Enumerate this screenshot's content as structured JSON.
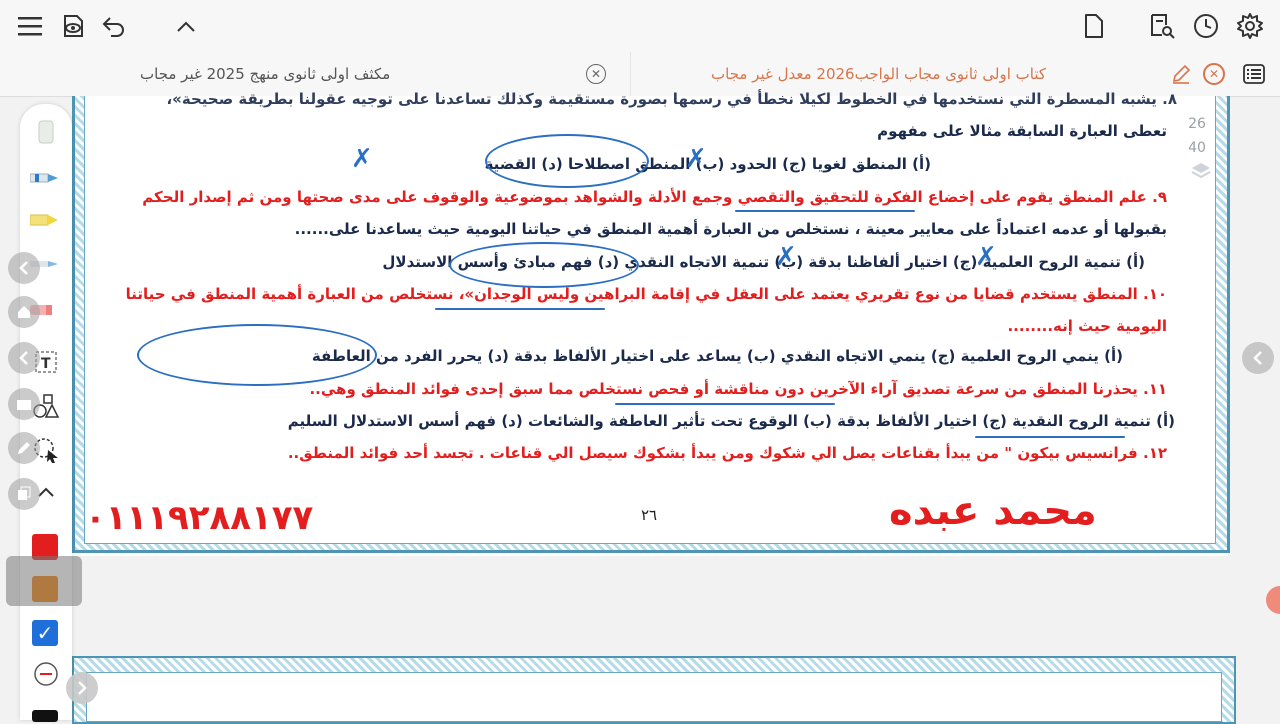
{
  "tabs": {
    "left_label": "مكثف اولى ثانوى منهج 2025  غير مجاب",
    "right_label": "كتاب اولى  ثانوى مجاب الواجب2026 معدل غير مجاب"
  },
  "icons": {
    "top_left": [
      "menu-icon",
      "eye-icon",
      "undo-icon",
      "chevron-up-icon"
    ],
    "top_right": [
      "page-icon",
      "search-doc-icon",
      "clock-icon",
      "gear-icon"
    ]
  },
  "thumb_numbers": [
    "26",
    "40"
  ],
  "content": {
    "q8_cut": "٨. يشبه المسطرة التي نستخدمها في الخطوط لكيلا نخطأ في رسمها بصورة مستقيمة وكذلك تساعدنا على توجيه عقولنا بطريقة صحيحة»،",
    "q8_line2": "تعطى العبارة السابقة مثالا على مفهوم",
    "q8_opts": "(أ) المنطق لغويا      (ج) الحدود      (ب) المنطق اصطلاحا      (د) القضية",
    "q9_line1": "٩. علم المنطق يقوم على إخضاع الفكرة للتحقيق والتقصي وجمع الأدلة والشواهد بموضوعية والوقوف على مدى صحتها ومن ثم إصدار الحكم",
    "q9_line2": "بقبولها أو عدمه اعتماداً على معايير معينة ، نستخلص من العبارة أهمية المنطق في حياتنا اليومية حيث يساعدنا على......",
    "q9_opts": "(أ) تنمية الروح العلمية      (ج) اختيار ألفاظنا بدقة      (ب) تنمية الاتجاه النقدي      (د) فهم مبادئ وأسس الاستدلال",
    "q10_line1": "١٠. المنطق يستخدم قضايا من نوع تقريري يعتمد على العقل في إقامة البراهين وليس الوجدان»، نستخلص من العبارة أهمية المنطق في حياتنا",
    "q10_line2": "اليومية حيث إنه........",
    "q10_opts": "(أ) ينمي الروح العلمية      (ج) ينمي الاتجاه النقدي      (ب) يساعد على اختيار الألفاظ بدقة      (د) يحرر الفرد من العاطفة",
    "q11_line1": "١١. يحذرنا المنطق من سرعة تصديق آراء الآخرين دون مناقشة أو فحص نستخلص مما سبق إحدى فوائد المنطق وهي..",
    "q11_opts": "(أ) تنمية الروح النقدية      (ج) اختيار الألفاظ بدقة      (ب) الوقوع تحت تأثير العاطفة والشائعات      (د) فهم أسس الاستدلال السليم",
    "q12_line1": "١٢. فرانسيس بيكون \" من يبدأ بقناعات يصل الي شكوك ومن يبدأ بشكوك سيصل الي قناعات . تجسد أحد فوائد المنطق..",
    "phone": "٠١١١٩٢٨٨١٧٧",
    "page_number": "٢٦",
    "author": "محمد عبده"
  },
  "colors": {
    "red": "#e31e1e",
    "orange": "#ef7d00",
    "blue": "#1e6fd9",
    "frame": "#4e95b3",
    "tab_accent": "#d9744a"
  },
  "palette": [
    "red",
    "orange",
    "blue-checked"
  ]
}
